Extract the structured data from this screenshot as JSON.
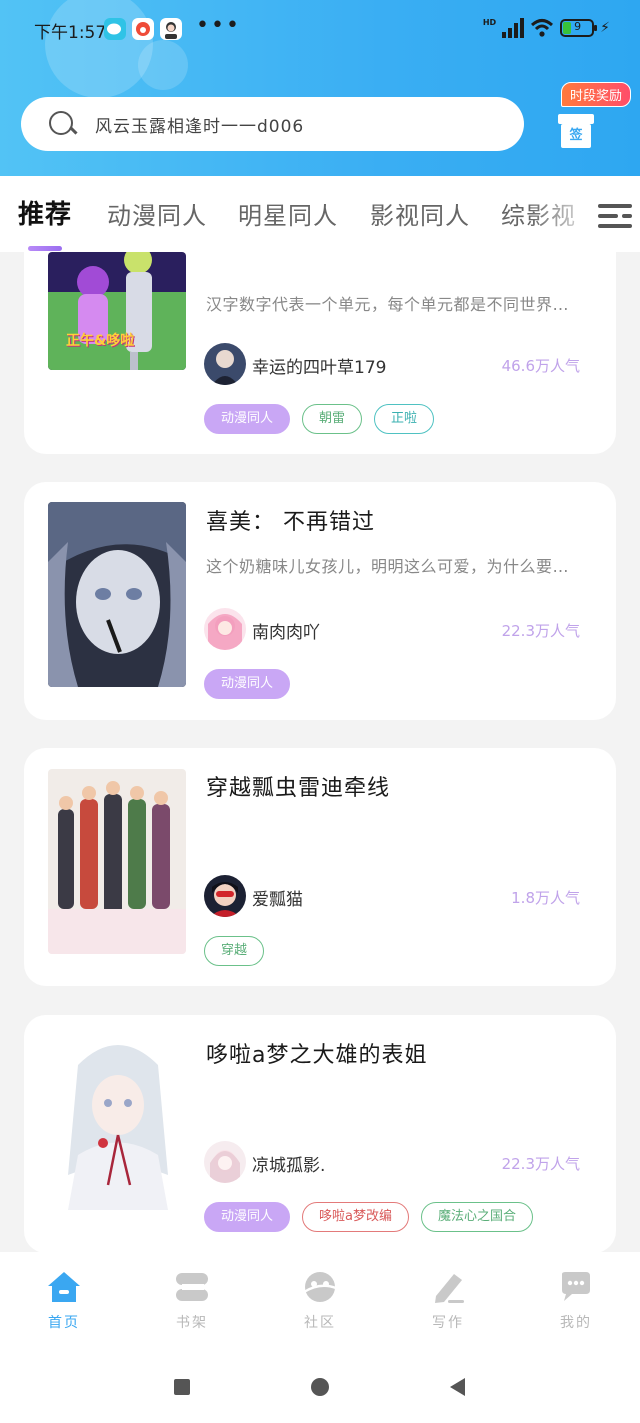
{
  "status_bar": {
    "time": "下午1:57",
    "hd": "HD",
    "battery": "9",
    "apps": [
      "wechat-icon",
      "weibo-icon",
      "avatar-icon"
    ],
    "more": "•••"
  },
  "search": {
    "placeholder": "风云玉露相逢时一一d006"
  },
  "reward": {
    "badge": "时段奖励",
    "gift_label": "签"
  },
  "tabs": [
    {
      "label": "推荐",
      "active": true
    },
    {
      "label": "动漫同人",
      "active": false
    },
    {
      "label": "明星同人",
      "active": false
    },
    {
      "label": "影视同人",
      "active": false
    },
    {
      "label": "综影视",
      "active": false
    }
  ],
  "books": [
    {
      "title": "",
      "description": "汉字数字代表一个单元，每个单元都是不同世界…",
      "author": "幸运的四叶草179",
      "popularity": "46.6万人气",
      "cover_caption": "正午&哆啦",
      "tags": [
        {
          "label": "动漫同人",
          "style": "filled-purple"
        },
        {
          "label": "朝雷",
          "style": "outline-green"
        },
        {
          "label": "正啦",
          "style": "outline-teal"
        }
      ]
    },
    {
      "title": "喜美： 不再错过",
      "description": "这个奶糖味儿女孩儿，明明这么可爱，为什么要…",
      "author": "南肉肉吖",
      "popularity": "22.3万人气",
      "tags": [
        {
          "label": "动漫同人",
          "style": "filled-purple"
        }
      ]
    },
    {
      "title": "穿越瓢虫雷迪牵线",
      "description": "",
      "author": "爱瓢猫",
      "popularity": "1.8万人气",
      "tags": [
        {
          "label": "穿越",
          "style": "outline-green"
        }
      ]
    },
    {
      "title": "哆啦a梦之大雄的表姐",
      "description": "",
      "author": "凉城孤影.",
      "popularity": "22.3万人气",
      "tags": [
        {
          "label": "动漫同人",
          "style": "filled-purple"
        },
        {
          "label": "哆啦a梦改编",
          "style": "outline-red"
        },
        {
          "label": "魔法心之国合",
          "style": "outline-green"
        }
      ]
    }
  ],
  "bottom_nav": [
    {
      "label": "首页",
      "icon": "home-icon",
      "active": true
    },
    {
      "label": "书架",
      "icon": "bookshelf-icon",
      "active": false
    },
    {
      "label": "社区",
      "icon": "community-icon",
      "active": false
    },
    {
      "label": "写作",
      "icon": "pen-icon",
      "active": false
    },
    {
      "label": "我的",
      "icon": "message-icon",
      "active": false
    }
  ],
  "colors": {
    "header_blue": "#3aaef3",
    "accent_purple": "#c9a7f5",
    "nav_active": "#3aa7f1"
  }
}
